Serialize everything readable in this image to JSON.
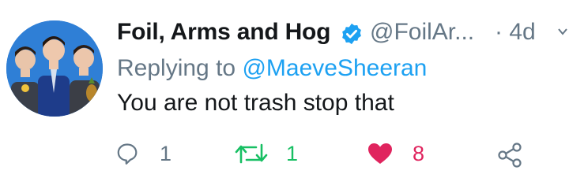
{
  "tweet": {
    "display_name": "Foil, Arms and Hog",
    "handle": "@FoilAr...",
    "time": "· 4d",
    "reply_prefix": "Replying to",
    "reply_to": "@MaeveSheeran",
    "text": "You are not trash stop that",
    "verified": true
  },
  "actions": {
    "reply_count": "1",
    "retweet_count": "1",
    "like_count": "8",
    "liked": true
  },
  "colors": {
    "primary_text": "#14171a",
    "secondary_text": "#657786",
    "link": "#1da1f2",
    "retweet_green": "#17bf63",
    "like_red": "#e0245e"
  },
  "icons": {
    "verified": "verified-badge-icon",
    "more": "chevron-down-icon",
    "reply": "reply-bubble-icon",
    "retweet": "retweet-icon",
    "like": "heart-icon",
    "share": "share-icon"
  }
}
